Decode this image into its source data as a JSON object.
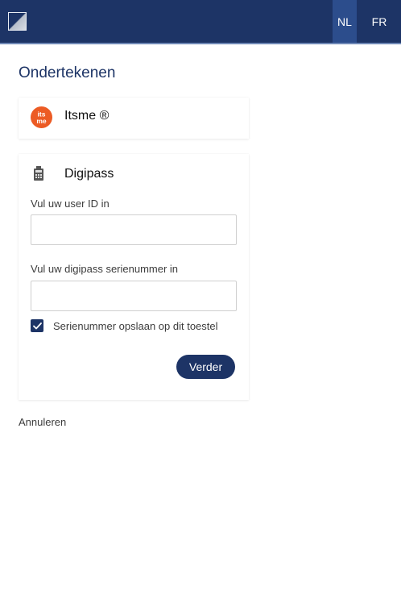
{
  "header": {
    "languages": [
      {
        "code": "NL",
        "active": true
      },
      {
        "code": "FR",
        "active": false
      }
    ]
  },
  "page": {
    "title": "Ondertekenen"
  },
  "methods": {
    "itsme": {
      "label": "Itsme ®",
      "logo_text_top": "its",
      "logo_text_bottom": "me",
      "icon": "itsme-logo-icon"
    },
    "digipass": {
      "label": "Digipass",
      "icon": "digipass-device-icon",
      "user_id_label": "Vul uw user ID in",
      "user_id_value": "",
      "serial_label": "Vul uw digipass serienummer in",
      "serial_value": "",
      "save_serial_label": "Serienummer opslaan op dit toestel",
      "save_serial_checked": true,
      "next_button": "Verder"
    }
  },
  "footer": {
    "cancel_label": "Annuleren"
  },
  "colors": {
    "primary": "#1d3466",
    "active_language": "#2c4d8c",
    "itsme_brand": "#ec5b24"
  }
}
